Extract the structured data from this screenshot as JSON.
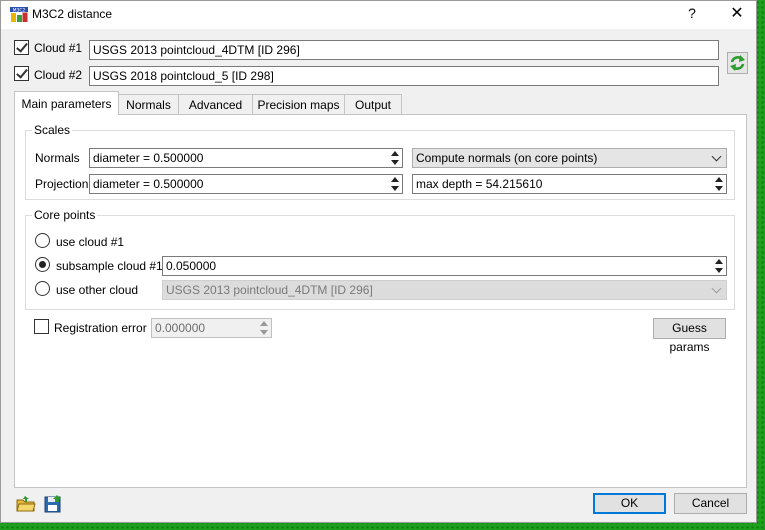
{
  "window": {
    "title": "M3C2 distance",
    "help_glyph": "?",
    "close_glyph": "✕",
    "icon_text": "M3C2"
  },
  "clouds": {
    "cloud1_label": "Cloud #1",
    "cloud1_value": "USGS 2013 pointcloud_4DTM [ID 296]",
    "cloud1_checked": true,
    "cloud2_label": "Cloud #2",
    "cloud2_value": "USGS 2018 pointcloud_5 [ID 298]",
    "cloud2_checked": true
  },
  "tabs": [
    {
      "label": "Main parameters",
      "active": true
    },
    {
      "label": "Normals",
      "active": false
    },
    {
      "label": "Advanced",
      "active": false
    },
    {
      "label": "Precision maps",
      "active": false
    },
    {
      "label": "Output",
      "active": false
    }
  ],
  "scales": {
    "title": "Scales",
    "normals_label": "Normals",
    "normals_value": "diameter = 0.500000",
    "normals_mode": "Compute normals (on core points)",
    "projection_label": "Projection",
    "projection_value": "diameter = 0.500000",
    "max_depth_value": "max depth = 54.215610"
  },
  "core_points": {
    "title": "Core points",
    "use_cloud1_label": "use cloud #1",
    "subsample_label": "subsample cloud #1",
    "subsample_value": "0.050000",
    "use_other_label": "use other cloud",
    "other_cloud_value": "USGS 2013 pointcloud_4DTM [ID 296]",
    "selected": "subsample"
  },
  "registration": {
    "label": "Registration error",
    "value": "0.000000",
    "checked": false
  },
  "buttons": {
    "guess_params": "Guess params",
    "ok": "OK",
    "cancel": "Cancel"
  },
  "colors": {
    "accent": "#0078d7",
    "desktop_green": "#1ea01e"
  }
}
